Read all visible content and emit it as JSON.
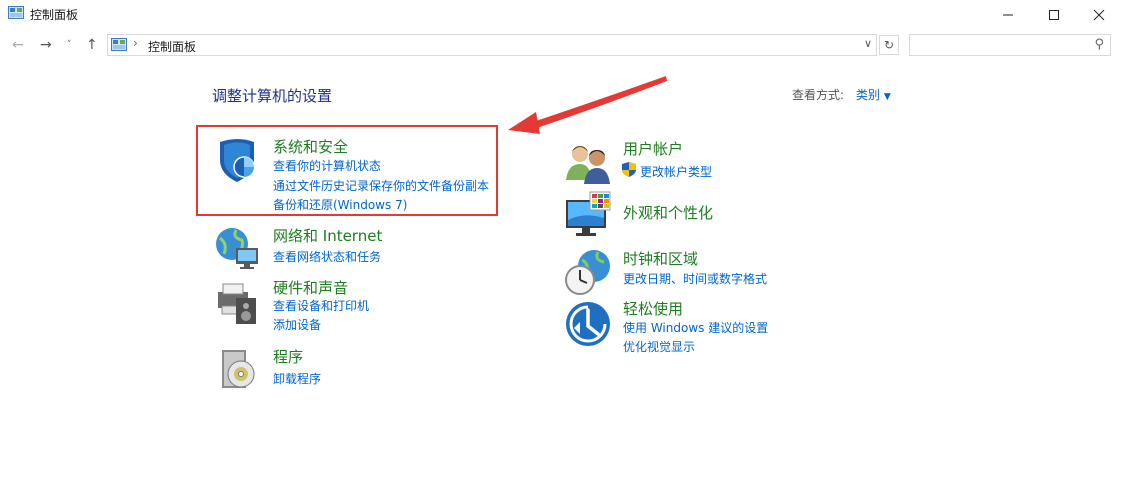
{
  "window": {
    "title": "控制面板"
  },
  "address": {
    "path": "控制面板"
  },
  "search": {
    "placeholder": ""
  },
  "main": {
    "heading": "调整计算机的设置",
    "view_label": "查看方式:",
    "view_value": "类别"
  },
  "categories": [
    {
      "title": "系统和安全",
      "links": [
        "查看你的计算机状态",
        "通过文件历史记录保存你的文件备份副本",
        "备份和还原(Windows 7)"
      ]
    },
    {
      "title": "网络和 Internet",
      "links": [
        "查看网络状态和任务"
      ]
    },
    {
      "title": "硬件和声音",
      "links": [
        "查看设备和打印机",
        "添加设备"
      ]
    },
    {
      "title": "程序",
      "links": [
        "卸载程序"
      ]
    },
    {
      "title": "用户帐户",
      "links": [
        "更改帐户类型"
      ]
    },
    {
      "title": "外观和个性化",
      "links": []
    },
    {
      "title": "时钟和区域",
      "links": [
        "更改日期、时间或数字格式"
      ]
    },
    {
      "title": "轻松使用",
      "links": [
        "使用 Windows 建议的设置",
        "优化视觉显示"
      ]
    }
  ],
  "colors": {
    "accent": "#0066cc",
    "category_title": "#1e7d1e",
    "heading": "#1e3287",
    "annotation": "#e53935"
  }
}
